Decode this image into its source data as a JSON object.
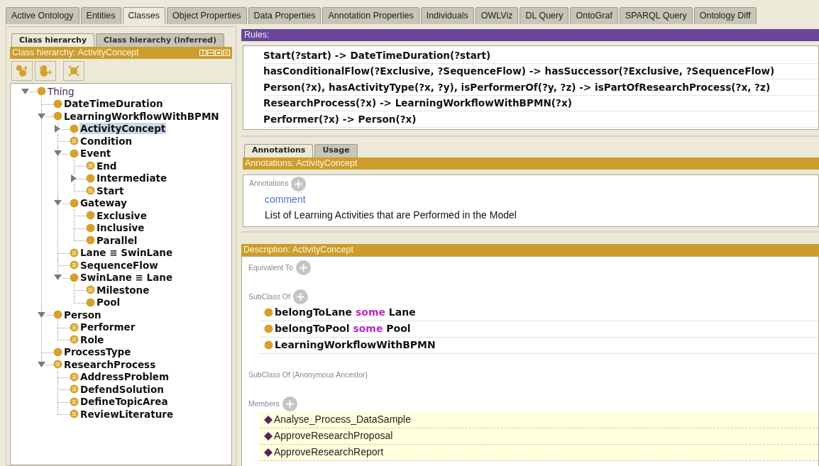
{
  "main_tabs": [
    {
      "label": "Active Ontology",
      "selected": false
    },
    {
      "label": "Entities",
      "selected": false
    },
    {
      "label": "Classes",
      "selected": true
    },
    {
      "label": "Object Properties",
      "selected": false
    },
    {
      "label": "Data Properties",
      "selected": false
    },
    {
      "label": "Annotation Properties",
      "selected": false
    },
    {
      "label": "Individuals",
      "selected": false
    },
    {
      "label": "OWLViz",
      "selected": false
    },
    {
      "label": "DL Query",
      "selected": false
    },
    {
      "label": "OntoGraf",
      "selected": false
    },
    {
      "label": "SPARQL Query",
      "selected": false
    },
    {
      "label": "Ontology Diff",
      "selected": false
    }
  ],
  "class_panel": {
    "tabs": [
      {
        "label": "Class hierarchy",
        "selected": true
      },
      {
        "label": "Class hierarchy (inferred)",
        "selected": false
      }
    ],
    "header": "Class hierarchy: ActivityConcept",
    "tree": [
      {
        "label": "Thing",
        "kind": "primitive",
        "expanded": true,
        "selected": false,
        "children": [
          {
            "label": "DateTimeDuration",
            "kind": "primitive",
            "selected": false
          },
          {
            "label": "LearningWorkflowWithBPMN",
            "kind": "primitive",
            "expanded": true,
            "selected": false,
            "children": [
              {
                "label": "ActivityConcept",
                "kind": "primitive",
                "expanded": false,
                "selected": true
              },
              {
                "label": "Condition",
                "kind": "defined",
                "selected": false
              },
              {
                "label": "Event",
                "kind": "primitive",
                "expanded": true,
                "selected": false,
                "children": [
                  {
                    "label": "End",
                    "kind": "defined",
                    "selected": false
                  },
                  {
                    "label": "Intermediate",
                    "kind": "primitive",
                    "expanded": false,
                    "selected": false
                  },
                  {
                    "label": "Start",
                    "kind": "defined",
                    "selected": false
                  }
                ]
              },
              {
                "label": "Gateway",
                "kind": "primitive",
                "expanded": true,
                "selected": false,
                "children": [
                  {
                    "label": "Exclusive",
                    "kind": "primitive",
                    "selected": false
                  },
                  {
                    "label": "Inclusive",
                    "kind": "primitive",
                    "selected": false
                  },
                  {
                    "label": "Parallel",
                    "kind": "primitive",
                    "selected": false
                  }
                ]
              },
              {
                "label": "Lane ≡ SwinLane",
                "kind": "defined",
                "selected": false
              },
              {
                "label": "SequenceFlow",
                "kind": "defined",
                "selected": false
              },
              {
                "label": "SwinLane ≡ Lane",
                "kind": "primitive",
                "expanded": true,
                "selected": false,
                "children": [
                  {
                    "label": "Milestone",
                    "kind": "defined",
                    "selected": false
                  },
                  {
                    "label": "Pool",
                    "kind": "primitive",
                    "selected": false
                  }
                ]
              }
            ]
          },
          {
            "label": "Person",
            "kind": "primitive",
            "expanded": true,
            "selected": false,
            "children": [
              {
                "label": "Performer",
                "kind": "defined",
                "selected": false
              },
              {
                "label": "Role",
                "kind": "defined",
                "selected": false
              }
            ]
          },
          {
            "label": "ProcessType",
            "kind": "primitive",
            "selected": false
          },
          {
            "label": "ResearchProcess",
            "kind": "defined",
            "expanded": true,
            "selected": false,
            "children": [
              {
                "label": "AddressProblem",
                "kind": "defined",
                "selected": false
              },
              {
                "label": "DefendSolution",
                "kind": "defined",
                "selected": false
              },
              {
                "label": "DefineTopicArea",
                "kind": "defined",
                "selected": false
              },
              {
                "label": "ReviewLiterature",
                "kind": "defined",
                "selected": false
              }
            ]
          }
        ]
      }
    ]
  },
  "rules": {
    "header": "Rules:",
    "items": [
      "Start(?start) -> DateTimeDuration(?start)",
      "hasConditionalFlow(?Exclusive, ?SequenceFlow) -> hasSuccessor(?Exclusive, ?SequenceFlow)",
      "Person(?x), hasActivityType(?x, ?y), isPerformerOf(?y, ?z) -> isPartOfResearchProcess(?x, ?z)",
      "ResearchProcess(?x) -> LearningWorkflowWithBPMN(?x)",
      "Performer(?x) -> Person(?x)"
    ]
  },
  "annotations_panel": {
    "tabs": [
      {
        "label": "Annotations",
        "selected": true
      },
      {
        "label": "Usage",
        "selected": false
      }
    ],
    "header": "Annotations: ActivityConcept",
    "section_label": "Annotations",
    "items": [
      {
        "property": "comment",
        "value": "List of Learning Activities that are Performed in the Model"
      }
    ]
  },
  "description": {
    "header": "Description: ActivityConcept",
    "sections": [
      {
        "label": "Equivalent To",
        "add_button": true
      },
      {
        "label": "SubClass Of",
        "add_button": true,
        "items": [
          {
            "kind": "class",
            "parts": [
              {
                "kind": "name",
                "text": "belongToLane"
              },
              {
                "kind": "keyword",
                "text": "some"
              },
              {
                "kind": "name",
                "text": "Lane"
              }
            ]
          },
          {
            "kind": "class",
            "parts": [
              {
                "kind": "name",
                "text": "belongToPool"
              },
              {
                "kind": "keyword",
                "text": "some"
              },
              {
                "kind": "name",
                "text": "Pool"
              }
            ]
          },
          {
            "kind": "class",
            "parts": [
              {
                "kind": "name",
                "text": "LearningWorkflowWithBPMN"
              }
            ]
          }
        ]
      },
      {
        "label": "SubClass Of (Anonymous Ancestor)",
        "add_button": false
      },
      {
        "label": "Members",
        "add_button": true,
        "items": [
          {
            "kind": "individual",
            "parts": [
              {
                "kind": "plain",
                "text": "Analyse_Process_DataSample"
              }
            ]
          },
          {
            "kind": "individual",
            "parts": [
              {
                "kind": "plain",
                "text": "ApproveResearchProposal"
              }
            ]
          },
          {
            "kind": "individual",
            "parts": [
              {
                "kind": "plain",
                "text": "ApproveResearchReport"
              }
            ]
          }
        ]
      }
    ]
  }
}
